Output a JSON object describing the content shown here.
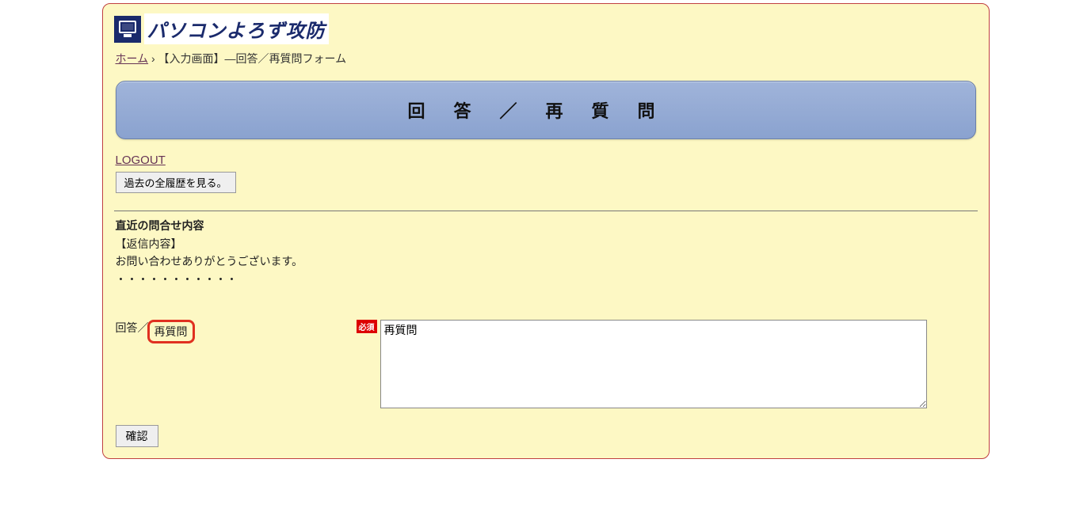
{
  "logo": {
    "text": "パソコンよろず攻防"
  },
  "breadcrumb": {
    "home_label": "ホーム",
    "separator": "›",
    "current": "【入力画面】―回答／再質問フォーム"
  },
  "banner": {
    "title": "回答／再質問"
  },
  "logout_label": "LOGOUT",
  "history_button_label": "過去の全履歴を見る。",
  "inquiry": {
    "section_title": "直近の問合せ内容",
    "reply_heading": "【返信内容】",
    "reply_body_line1": "お問い合わせありがとうございます。",
    "reply_body_line2": "・・・・・・・・・・・"
  },
  "form": {
    "label_prefix": "回答／",
    "label_highlight": "再質問",
    "required_badge": "必須",
    "textarea_value": "再質問",
    "confirm_button": "確認"
  }
}
